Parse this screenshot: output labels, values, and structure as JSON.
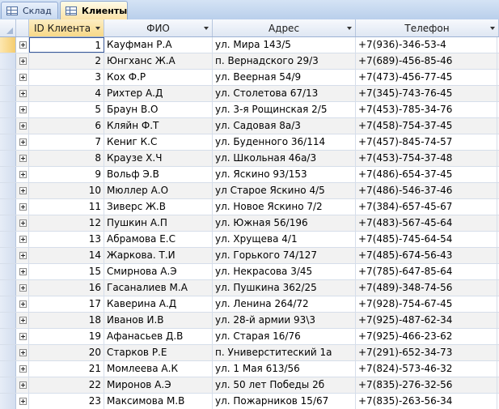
{
  "tabs": [
    {
      "label": "Склад",
      "active": false,
      "icon": "table-icon"
    },
    {
      "label": "Клиенты",
      "active": true,
      "icon": "table-icon"
    }
  ],
  "columns": [
    {
      "key": "id",
      "label": "ID Клиента"
    },
    {
      "key": "fio",
      "label": "ФИО"
    },
    {
      "key": "addr",
      "label": "Адрес"
    },
    {
      "key": "tel",
      "label": "Телефон"
    }
  ],
  "rows": [
    {
      "id": "1",
      "fio": "Кауфман Р.А",
      "addr": "ул. Мира 143/5",
      "tel": "+7(936)-346-53-4"
    },
    {
      "id": "2",
      "fio": "Юнгханс Ж.А",
      "addr": "п. Вернадского 29/3",
      "tel": "+7(689)-456-85-46"
    },
    {
      "id": "3",
      "fio": "Кох Ф.Р",
      "addr": "ул. Веерная 54/9",
      "tel": "+7(473)-456-77-45"
    },
    {
      "id": "4",
      "fio": "Рихтер А.Д",
      "addr": "ул. Столетова 67/13",
      "tel": "+7(345)-743-76-45"
    },
    {
      "id": "5",
      "fio": "Браун В.О",
      "addr": "ул. 3-я Рощинская 2/5",
      "tel": "+7(453)-785-34-76"
    },
    {
      "id": "6",
      "fio": "Кляйн Ф.Т",
      "addr": "ул.  Садовая 8а/3",
      "tel": "+7(458)-754-37-45"
    },
    {
      "id": "7",
      "fio": "Кениг К.С",
      "addr": "ул. Буденного 36/114",
      "tel": "+7(457)-845-74-57"
    },
    {
      "id": "8",
      "fio": "Краузе Х.Ч",
      "addr": "ул. Школьная 46а/3",
      "tel": "+7(453)-754-37-48"
    },
    {
      "id": "9",
      "fio": "Вольф Э.В",
      "addr": "ул. Яскино 93/153",
      "tel": "+7(486)-654-37-45"
    },
    {
      "id": "10",
      "fio": "Мюллер А.О",
      "addr": "ул Старое Яскино 4/5",
      "tel": "+7(486)-546-37-46"
    },
    {
      "id": "11",
      "fio": "Зиверс Ж.В",
      "addr": "ул. Новое Яскино 7/2",
      "tel": "+7(384)-657-45-67"
    },
    {
      "id": "12",
      "fio": "Пушкин А.П",
      "addr": "ул. Южная 56/196",
      "tel": "+7(483)-567-45-64"
    },
    {
      "id": "13",
      "fio": "Абрамова Е.С",
      "addr": "ул. Хрущева 4/1",
      "tel": "+7(485)-745-64-54"
    },
    {
      "id": "14",
      "fio": "Жаркова. Т.И",
      "addr": "ул. Горького 74/127",
      "tel": "+7(485)-674-56-43"
    },
    {
      "id": "15",
      "fio": "Смирнова А.Э",
      "addr": "ул. Некрасова 3/45",
      "tel": "+7(785)-647-85-64"
    },
    {
      "id": "16",
      "fio": "Гасаналиев М.А",
      "addr": "ул. Пушкина 362/25",
      "tel": "+7(489)-348-74-56"
    },
    {
      "id": "17",
      "fio": "Каверина А.Д",
      "addr": "ул. Ленина 264/72",
      "tel": "+7(928)-754-67-45"
    },
    {
      "id": "18",
      "fio": "Иванов И.В",
      "addr": "ул. 28-й армии 93\\3",
      "tel": "+7(925)-487-62-34"
    },
    {
      "id": "19",
      "fio": "Афанасьев Д.В",
      "addr": "ул. Старая 16/76",
      "tel": "+7(925)-466-23-62"
    },
    {
      "id": "20",
      "fio": "Старков Р.Е",
      "addr": "п. Универститеский 1а",
      "tel": "+7(291)-652-34-73"
    },
    {
      "id": "21",
      "fio": "Момлеева А.К",
      "addr": "ул. 1 Мая 613/56",
      "tel": "+7(824)-573-46-32"
    },
    {
      "id": "22",
      "fio": "Миронов А.Э",
      "addr": "ул. 50 лет Победы 2б",
      "tel": "+7(835)-276-32-56"
    },
    {
      "id": "23",
      "fio": "Максимова М.В",
      "addr": "ул. Пожарников 15/67",
      "tel": "+7(835)-263-56-34"
    }
  ],
  "colors": {
    "active_tab": "#fbe2a6",
    "header_active": "#f7d988",
    "alt_row": "#f2f2f2"
  }
}
